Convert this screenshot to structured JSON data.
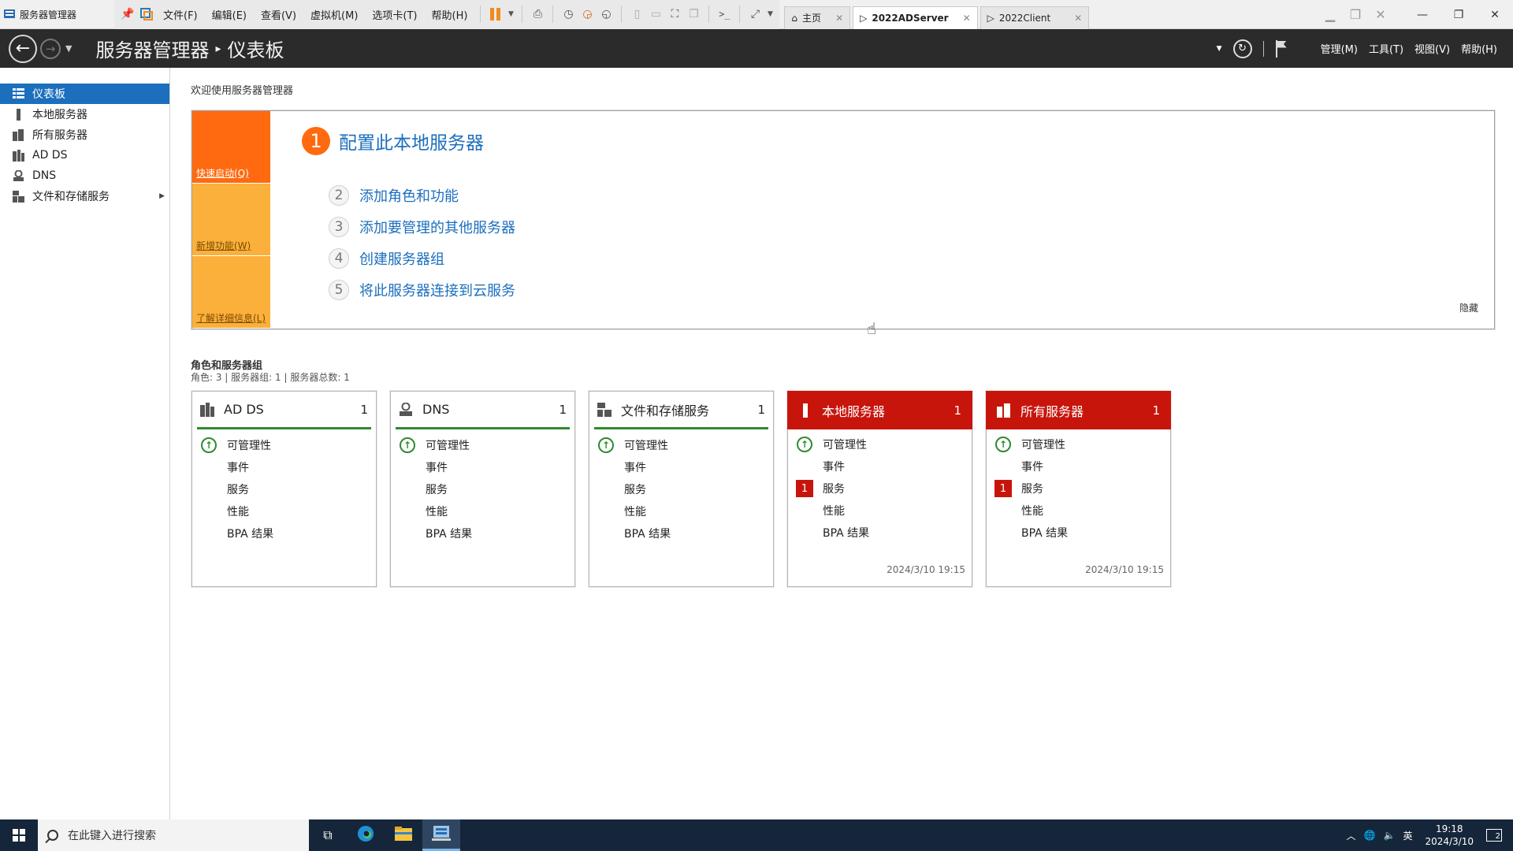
{
  "window": {
    "title": "服务器管理器",
    "menus": [
      "文件(F)",
      "编辑(E)",
      "查看(V)",
      "虚拟机(M)",
      "选项卡(T)",
      "帮助(H)"
    ],
    "tabs": [
      {
        "label": "主页",
        "active": false
      },
      {
        "label": "2022ADServer",
        "active": true
      },
      {
        "label": "2022Client",
        "active": false
      }
    ]
  },
  "header": {
    "app": "服务器管理器",
    "separator": "▸",
    "page": "仪表板",
    "menus": [
      "管理(M)",
      "工具(T)",
      "视图(V)",
      "帮助(H)"
    ]
  },
  "sidebar": {
    "items": [
      {
        "label": "仪表板",
        "icon": "dashboard-icon",
        "active": true
      },
      {
        "label": "本地服务器",
        "icon": "local-server-icon",
        "active": false
      },
      {
        "label": "所有服务器",
        "icon": "all-servers-icon",
        "active": false
      },
      {
        "label": "AD DS",
        "icon": "adds-icon",
        "active": false
      },
      {
        "label": "DNS",
        "icon": "dns-icon",
        "active": false
      },
      {
        "label": "文件和存储服务",
        "icon": "file-storage-icon",
        "active": false,
        "expandable": true
      }
    ]
  },
  "welcome": {
    "label": "欢迎使用服务器管理器",
    "tiles": [
      "快速启动(Q)",
      "新增功能(W)",
      "了解详细信息(L)"
    ],
    "main_step": {
      "num": "1",
      "label": "配置此本地服务器"
    },
    "steps": [
      {
        "num": "2",
        "label": "添加角色和功能"
      },
      {
        "num": "3",
        "label": "添加要管理的其他服务器"
      },
      {
        "num": "4",
        "label": "创建服务器组"
      },
      {
        "num": "5",
        "label": "将此服务器连接到云服务"
      }
    ],
    "hide": "隐藏"
  },
  "roles": {
    "title": "角色和服务器组",
    "subtitle": "角色: 3 | 服务器组: 1 | 服务器总数: 1",
    "row_labels": [
      "可管理性",
      "事件",
      "服务",
      "性能",
      "BPA 结果"
    ],
    "tiles": [
      {
        "name": "AD DS",
        "count": "1",
        "status": "ok",
        "service_errors": "",
        "timestamp": ""
      },
      {
        "name": "DNS",
        "count": "1",
        "status": "ok",
        "service_errors": "",
        "timestamp": ""
      },
      {
        "name": "文件和存储服务",
        "count": "1",
        "status": "ok",
        "service_errors": "",
        "timestamp": ""
      },
      {
        "name": "本地服务器",
        "count": "1",
        "status": "alert",
        "service_errors": "1",
        "timestamp": "2024/3/10 19:15"
      },
      {
        "name": "所有服务器",
        "count": "1",
        "status": "alert",
        "service_errors": "1",
        "timestamp": "2024/3/10 19:15"
      }
    ]
  },
  "taskbar": {
    "search_placeholder": "在此键入进行搜索",
    "ime": "英",
    "time": "19:18",
    "date": "2024/3/10",
    "notifications": "2"
  },
  "colors": {
    "accent": "#1c6fbd",
    "orange": "#ff6a10",
    "amber": "#fbb03b",
    "alert_red": "#c8150c",
    "ok_green": "#2e8b2e",
    "header_bg": "#2b2b2b"
  }
}
